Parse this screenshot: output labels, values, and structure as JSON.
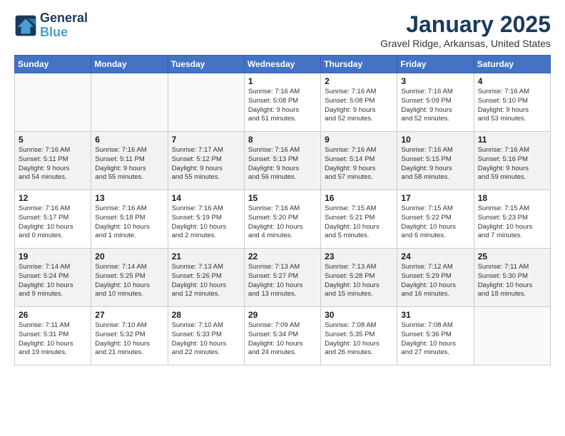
{
  "header": {
    "logo_line1": "General",
    "logo_line2": "Blue",
    "month": "January 2025",
    "location": "Gravel Ridge, Arkansas, United States"
  },
  "days_of_week": [
    "Sunday",
    "Monday",
    "Tuesday",
    "Wednesday",
    "Thursday",
    "Friday",
    "Saturday"
  ],
  "weeks": [
    [
      {
        "day": "",
        "info": ""
      },
      {
        "day": "",
        "info": ""
      },
      {
        "day": "",
        "info": ""
      },
      {
        "day": "1",
        "info": "Sunrise: 7:16 AM\nSunset: 5:08 PM\nDaylight: 9 hours\nand 51 minutes."
      },
      {
        "day": "2",
        "info": "Sunrise: 7:16 AM\nSunset: 5:08 PM\nDaylight: 9 hours\nand 52 minutes."
      },
      {
        "day": "3",
        "info": "Sunrise: 7:16 AM\nSunset: 5:09 PM\nDaylight: 9 hours\nand 52 minutes."
      },
      {
        "day": "4",
        "info": "Sunrise: 7:16 AM\nSunset: 5:10 PM\nDaylight: 9 hours\nand 53 minutes."
      }
    ],
    [
      {
        "day": "5",
        "info": "Sunrise: 7:16 AM\nSunset: 5:11 PM\nDaylight: 9 hours\nand 54 minutes."
      },
      {
        "day": "6",
        "info": "Sunrise: 7:16 AM\nSunset: 5:11 PM\nDaylight: 9 hours\nand 55 minutes."
      },
      {
        "day": "7",
        "info": "Sunrise: 7:17 AM\nSunset: 5:12 PM\nDaylight: 9 hours\nand 55 minutes."
      },
      {
        "day": "8",
        "info": "Sunrise: 7:16 AM\nSunset: 5:13 PM\nDaylight: 9 hours\nand 56 minutes."
      },
      {
        "day": "9",
        "info": "Sunrise: 7:16 AM\nSunset: 5:14 PM\nDaylight: 9 hours\nand 57 minutes."
      },
      {
        "day": "10",
        "info": "Sunrise: 7:16 AM\nSunset: 5:15 PM\nDaylight: 9 hours\nand 58 minutes."
      },
      {
        "day": "11",
        "info": "Sunrise: 7:16 AM\nSunset: 5:16 PM\nDaylight: 9 hours\nand 59 minutes."
      }
    ],
    [
      {
        "day": "12",
        "info": "Sunrise: 7:16 AM\nSunset: 5:17 PM\nDaylight: 10 hours\nand 0 minutes."
      },
      {
        "day": "13",
        "info": "Sunrise: 7:16 AM\nSunset: 5:18 PM\nDaylight: 10 hours\nand 1 minute."
      },
      {
        "day": "14",
        "info": "Sunrise: 7:16 AM\nSunset: 5:19 PM\nDaylight: 10 hours\nand 2 minutes."
      },
      {
        "day": "15",
        "info": "Sunrise: 7:16 AM\nSunset: 5:20 PM\nDaylight: 10 hours\nand 4 minutes."
      },
      {
        "day": "16",
        "info": "Sunrise: 7:15 AM\nSunset: 5:21 PM\nDaylight: 10 hours\nand 5 minutes."
      },
      {
        "day": "17",
        "info": "Sunrise: 7:15 AM\nSunset: 5:22 PM\nDaylight: 10 hours\nand 6 minutes."
      },
      {
        "day": "18",
        "info": "Sunrise: 7:15 AM\nSunset: 5:23 PM\nDaylight: 10 hours\nand 7 minutes."
      }
    ],
    [
      {
        "day": "19",
        "info": "Sunrise: 7:14 AM\nSunset: 5:24 PM\nDaylight: 10 hours\nand 9 minutes."
      },
      {
        "day": "20",
        "info": "Sunrise: 7:14 AM\nSunset: 5:25 PM\nDaylight: 10 hours\nand 10 minutes."
      },
      {
        "day": "21",
        "info": "Sunrise: 7:13 AM\nSunset: 5:26 PM\nDaylight: 10 hours\nand 12 minutes."
      },
      {
        "day": "22",
        "info": "Sunrise: 7:13 AM\nSunset: 5:27 PM\nDaylight: 10 hours\nand 13 minutes."
      },
      {
        "day": "23",
        "info": "Sunrise: 7:13 AM\nSunset: 5:28 PM\nDaylight: 10 hours\nand 15 minutes."
      },
      {
        "day": "24",
        "info": "Sunrise: 7:12 AM\nSunset: 5:29 PM\nDaylight: 10 hours\nand 16 minutes."
      },
      {
        "day": "25",
        "info": "Sunrise: 7:11 AM\nSunset: 5:30 PM\nDaylight: 10 hours\nand 18 minutes."
      }
    ],
    [
      {
        "day": "26",
        "info": "Sunrise: 7:11 AM\nSunset: 5:31 PM\nDaylight: 10 hours\nand 19 minutes."
      },
      {
        "day": "27",
        "info": "Sunrise: 7:10 AM\nSunset: 5:32 PM\nDaylight: 10 hours\nand 21 minutes."
      },
      {
        "day": "28",
        "info": "Sunrise: 7:10 AM\nSunset: 5:33 PM\nDaylight: 10 hours\nand 22 minutes."
      },
      {
        "day": "29",
        "info": "Sunrise: 7:09 AM\nSunset: 5:34 PM\nDaylight: 10 hours\nand 24 minutes."
      },
      {
        "day": "30",
        "info": "Sunrise: 7:08 AM\nSunset: 5:35 PM\nDaylight: 10 hours\nand 26 minutes."
      },
      {
        "day": "31",
        "info": "Sunrise: 7:08 AM\nSunset: 5:36 PM\nDaylight: 10 hours\nand 27 minutes."
      },
      {
        "day": "",
        "info": ""
      }
    ]
  ]
}
